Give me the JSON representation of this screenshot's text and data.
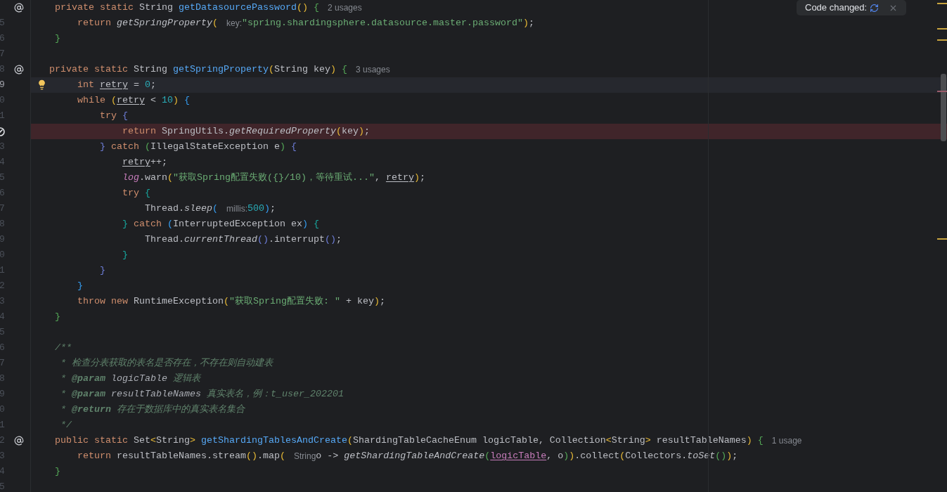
{
  "notification": {
    "text": "Code changed:"
  },
  "lines": [
    {
      "gutter": {
        "kind": "override"
      },
      "tokens": [
        {
          "kind": "kw",
          "t": "    private static "
        },
        {
          "kind": "p",
          "t": "String "
        },
        {
          "kind": "fn",
          "t": "getDatasourcePassword"
        },
        {
          "kind": "y",
          "t": "() "
        },
        {
          "kind": "g",
          "t": "{"
        },
        {
          "kind": "usage",
          "t": "2 usages"
        }
      ]
    },
    {
      "number": "5",
      "tokens": [
        {
          "kind": "kw",
          "t": "        return "
        },
        {
          "kind": "call",
          "t": "getSpringProperty"
        },
        {
          "kind": "y",
          "t": "("
        },
        {
          "kind": "hint",
          "t": "key:"
        },
        {
          "kind": "str",
          "t": "\"spring.shardingsphere.datasource.master.password\""
        },
        {
          "kind": "y",
          "t": ")"
        },
        {
          "kind": "p",
          "t": ";"
        }
      ]
    },
    {
      "number": "6",
      "tokens": [
        {
          "kind": "g",
          "t": "    }"
        }
      ]
    },
    {
      "number": "7"
    },
    {
      "number": "8",
      "gutter": {
        "kind": "override"
      },
      "tokens": [
        {
          "kind": "kw",
          "t": "   private static "
        },
        {
          "kind": "p",
          "t": "String "
        },
        {
          "kind": "fn",
          "t": "getSpringProperty"
        },
        {
          "kind": "y",
          "t": "("
        },
        {
          "kind": "p",
          "t": "String key"
        },
        {
          "kind": "y",
          "t": ") "
        },
        {
          "kind": "g",
          "t": "{"
        },
        {
          "kind": "usage",
          "t": "3 usages"
        }
      ]
    },
    {
      "number": "9",
      "gutter": {
        "kind": "bulb"
      },
      "highlight": {
        "kind": "current"
      },
      "tokens": [
        {
          "kind": "kw",
          "t": "        int "
        },
        {
          "kind": "var",
          "t": "retry"
        },
        {
          "kind": "p",
          "t": " = "
        },
        {
          "kind": "num",
          "t": "0"
        },
        {
          "kind": "p",
          "t": ";"
        }
      ]
    },
    {
      "number": "0",
      "tokens": [
        {
          "kind": "kw",
          "t": "        while "
        },
        {
          "kind": "y",
          "t": "("
        },
        {
          "kind": "var",
          "t": "retry"
        },
        {
          "kind": "p",
          "t": " < "
        },
        {
          "kind": "num",
          "t": "10"
        },
        {
          "kind": "y",
          "t": ") "
        },
        {
          "kind": "b",
          "t": "{"
        }
      ]
    },
    {
      "number": "1",
      "tokens": [
        {
          "kind": "kw",
          "t": "            try "
        },
        {
          "kind": "i",
          "t": "{"
        }
      ]
    },
    {
      "gutter": {
        "kind": "muted-breakpoint"
      },
      "highlight": {
        "kind": "error"
      },
      "tokens": [
        {
          "kind": "kw",
          "t": "                return "
        },
        {
          "kind": "p",
          "t": "SpringUtils."
        },
        {
          "kind": "call",
          "t": "getRequiredProperty"
        },
        {
          "kind": "y",
          "t": "("
        },
        {
          "kind": "p",
          "t": "key"
        },
        {
          "kind": "y",
          "t": ")"
        },
        {
          "kind": "p",
          "t": ";"
        }
      ]
    },
    {
      "number": "3",
      "tokens": [
        {
          "kind": "i",
          "t": "            } "
        },
        {
          "kind": "kw",
          "t": "catch "
        },
        {
          "kind": "g",
          "t": "("
        },
        {
          "kind": "p",
          "t": "IllegalStateException e"
        },
        {
          "kind": "g",
          "t": ") "
        },
        {
          "kind": "i",
          "t": "{"
        }
      ]
    },
    {
      "number": "4",
      "tokens": [
        {
          "kind": "var",
          "t": "                retry"
        },
        {
          "kind": "p",
          "t": "++;"
        }
      ]
    },
    {
      "number": "5",
      "tokens": [
        {
          "kind": "field",
          "t": "                log"
        },
        {
          "kind": "p",
          "t": ".warn"
        },
        {
          "kind": "y",
          "t": "("
        },
        {
          "kind": "str",
          "t": "\"获取Spring配置失败({}/10)，等待重试...\""
        },
        {
          "kind": "p",
          "t": ", "
        },
        {
          "kind": "var",
          "t": "retry"
        },
        {
          "kind": "y",
          "t": ")"
        },
        {
          "kind": "p",
          "t": ";"
        }
      ]
    },
    {
      "number": "6",
      "tokens": [
        {
          "kind": "kw",
          "t": "                try "
        },
        {
          "kind": "teal",
          "t": "{"
        }
      ]
    },
    {
      "number": "7",
      "tokens": [
        {
          "kind": "p",
          "t": "                    Thread."
        },
        {
          "kind": "call",
          "t": "sleep"
        },
        {
          "kind": "b",
          "t": "("
        },
        {
          "kind": "hint",
          "t": "millis:"
        },
        {
          "kind": "num",
          "t": "500"
        },
        {
          "kind": "b",
          "t": ")"
        },
        {
          "kind": "p",
          "t": ";"
        }
      ]
    },
    {
      "number": "8",
      "tokens": [
        {
          "kind": "teal",
          "t": "                } "
        },
        {
          "kind": "kw",
          "t": "catch "
        },
        {
          "kind": "b",
          "t": "("
        },
        {
          "kind": "p",
          "t": "InterruptedException ex"
        },
        {
          "kind": "b",
          "t": ") "
        },
        {
          "kind": "teal",
          "t": "{"
        }
      ]
    },
    {
      "number": "9",
      "tokens": [
        {
          "kind": "p",
          "t": "                    Thread."
        },
        {
          "kind": "call",
          "t": "currentThread"
        },
        {
          "kind": "i",
          "t": "()"
        },
        {
          "kind": "p",
          "t": ".interrupt"
        },
        {
          "kind": "i",
          "t": "()"
        },
        {
          "kind": "p",
          "t": ";"
        }
      ]
    },
    {
      "number": "0",
      "tokens": [
        {
          "kind": "teal",
          "t": "                }"
        }
      ]
    },
    {
      "number": "1",
      "tokens": [
        {
          "kind": "i",
          "t": "            }"
        }
      ]
    },
    {
      "number": "2",
      "tokens": [
        {
          "kind": "b",
          "t": "        }"
        }
      ]
    },
    {
      "number": "3",
      "tokens": [
        {
          "kind": "kw",
          "t": "        throw new "
        },
        {
          "kind": "p",
          "t": "RuntimeException"
        },
        {
          "kind": "y",
          "t": "("
        },
        {
          "kind": "str",
          "t": "\"获取Spring配置失败: \""
        },
        {
          "kind": "p",
          "t": " + key"
        },
        {
          "kind": "y",
          "t": ")"
        },
        {
          "kind": "p",
          "t": ";"
        }
      ]
    },
    {
      "number": "4",
      "tokens": [
        {
          "kind": "g",
          "t": "    }"
        }
      ]
    },
    {
      "number": "5"
    },
    {
      "number": "6",
      "tokens": [
        {
          "kind": "doc",
          "t": "    /**"
        }
      ]
    },
    {
      "number": "7",
      "tokens": [
        {
          "kind": "doc",
          "t": "     * 检查分表获取的表名是否存在，不存在则自动建表"
        }
      ]
    },
    {
      "number": "8",
      "tokens": [
        {
          "kind": "doc",
          "t": "     * "
        },
        {
          "kind": "tag",
          "t": "@param "
        },
        {
          "kind": "param",
          "t": "logicTable "
        },
        {
          "kind": "doc",
          "t": "逻辑表"
        }
      ]
    },
    {
      "number": "9",
      "tokens": [
        {
          "kind": "doc",
          "t": "     * "
        },
        {
          "kind": "tag",
          "t": "@param "
        },
        {
          "kind": "param",
          "t": "resultTableNames "
        },
        {
          "kind": "doc",
          "t": "真实表名，例：t_user_202201"
        }
      ]
    },
    {
      "number": "0",
      "tokens": [
        {
          "kind": "doc",
          "t": "     * "
        },
        {
          "kind": "tag",
          "t": "@return "
        },
        {
          "kind": "doc",
          "t": "存在于数据库中的真实表名集合"
        }
      ]
    },
    {
      "number": "1",
      "tokens": [
        {
          "kind": "doc",
          "t": "     */"
        }
      ]
    },
    {
      "number": "2",
      "gutter": {
        "kind": "override"
      },
      "tokens": [
        {
          "kind": "kw",
          "t": "    public static "
        },
        {
          "kind": "p",
          "t": "Set"
        },
        {
          "kind": "y",
          "t": "<"
        },
        {
          "kind": "p",
          "t": "String"
        },
        {
          "kind": "y",
          "t": "> "
        },
        {
          "kind": "fn",
          "t": "getShardingTablesAndCreate"
        },
        {
          "kind": "y",
          "t": "("
        },
        {
          "kind": "p",
          "t": "ShardingTableCacheEnum logicTable, Collection"
        },
        {
          "kind": "y",
          "t": "<"
        },
        {
          "kind": "p",
          "t": "String"
        },
        {
          "kind": "y",
          "t": ">"
        },
        {
          "kind": "p",
          "t": " resultTableNames"
        },
        {
          "kind": "y",
          "t": ") "
        },
        {
          "kind": "g",
          "t": "{"
        },
        {
          "kind": "usage",
          "t": "1 usage"
        }
      ]
    },
    {
      "number": "3",
      "tokens": [
        {
          "kind": "kw",
          "t": "        return "
        },
        {
          "kind": "p",
          "t": "resultTableNames.stream"
        },
        {
          "kind": "y",
          "t": "()"
        },
        {
          "kind": "p",
          "t": ".map"
        },
        {
          "kind": "y",
          "t": "("
        },
        {
          "kind": "hint",
          "t": "String"
        },
        {
          "kind": "p",
          "t": "o -> "
        },
        {
          "kind": "call",
          "t": "getShardingTableAndCreate"
        },
        {
          "kind": "g",
          "t": "("
        },
        {
          "kind": "lv",
          "t": "logicTable"
        },
        {
          "kind": "p",
          "t": ", o"
        },
        {
          "kind": "g",
          "t": ")"
        },
        {
          "kind": "y",
          "t": ")"
        },
        {
          "kind": "p",
          "t": ".collect"
        },
        {
          "kind": "y",
          "t": "("
        },
        {
          "kind": "p",
          "t": "Collectors."
        },
        {
          "kind": "call",
          "t": "toSet"
        },
        {
          "kind": "g",
          "t": "()"
        },
        {
          "kind": "y",
          "t": ")"
        },
        {
          "kind": "p",
          "t": ";"
        }
      ]
    },
    {
      "number": "4",
      "tokens": [
        {
          "kind": "g",
          "t": "    }"
        }
      ]
    },
    {
      "number": "5"
    }
  ]
}
